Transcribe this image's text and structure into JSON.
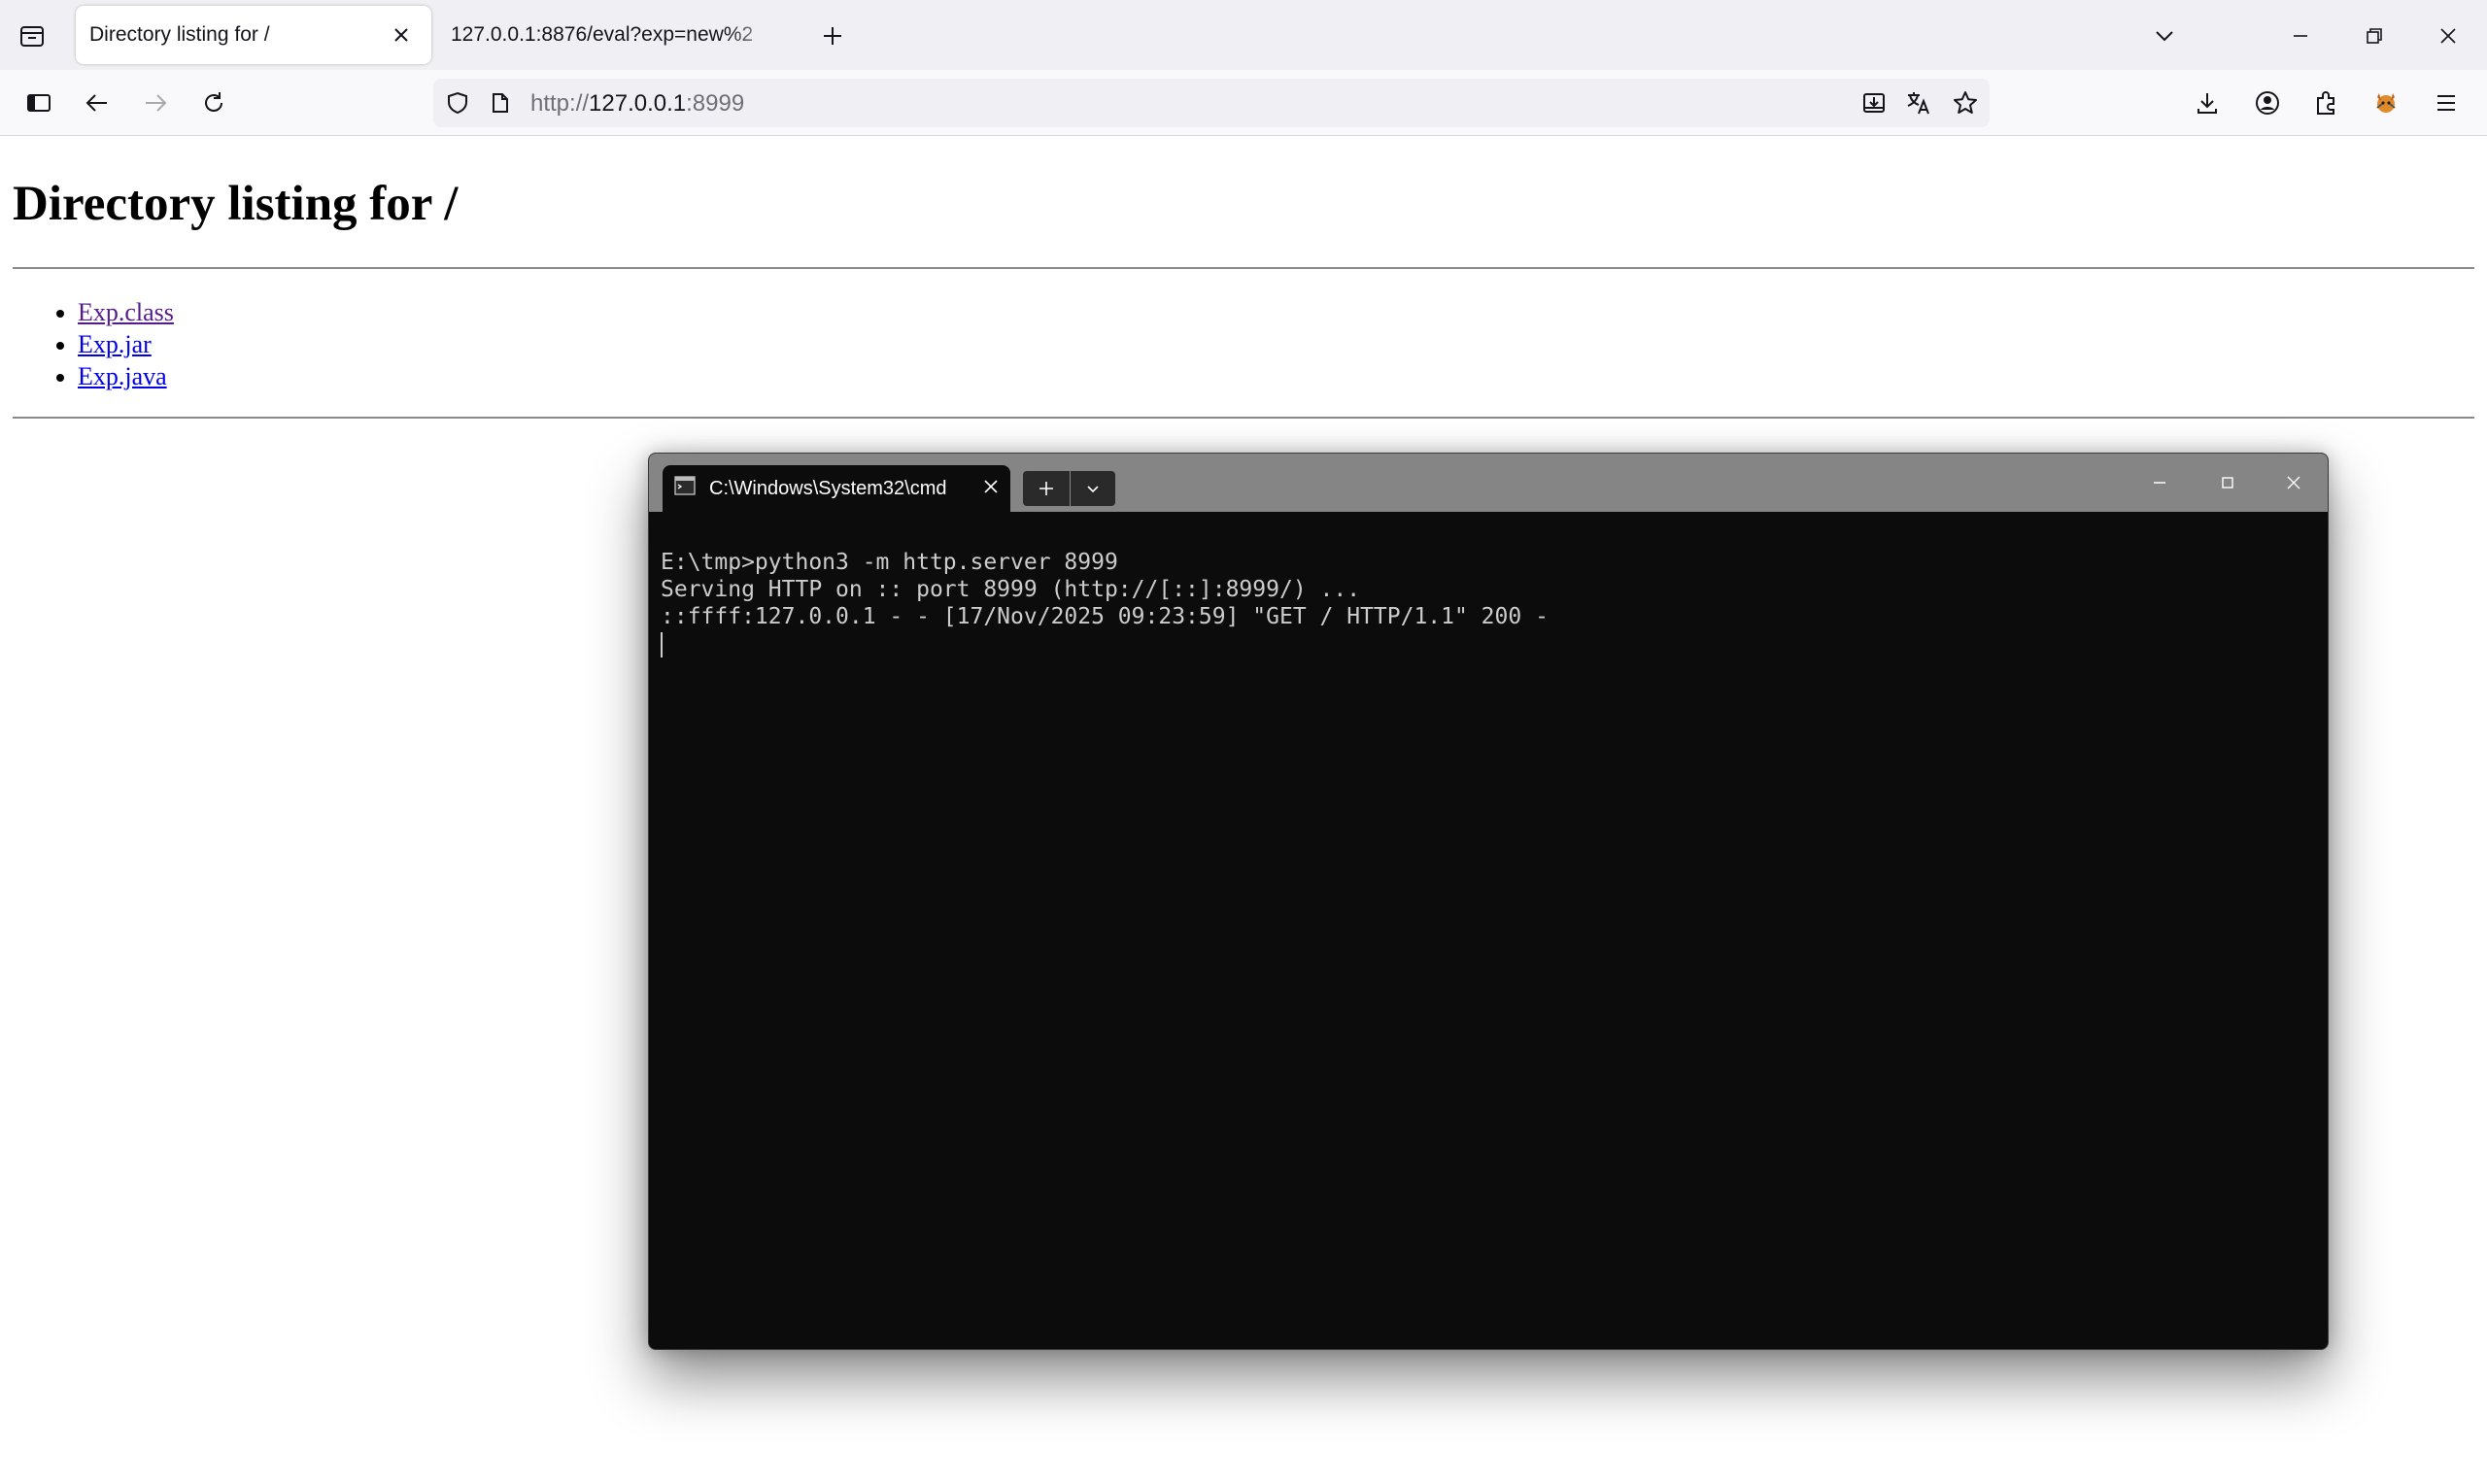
{
  "browser": {
    "tabs": [
      {
        "title": "Directory listing for /",
        "active": true
      },
      {
        "title": "127.0.0.1:8876/eval?exp=new%2",
        "active": false
      }
    ],
    "url": {
      "scheme": "http://",
      "host": "127.0.0.1",
      "port": ":8999"
    }
  },
  "page": {
    "heading": "Directory listing for /",
    "files": [
      {
        "name": "Exp.class",
        "visited": true
      },
      {
        "name": "Exp.jar",
        "visited": false
      },
      {
        "name": "Exp.java",
        "visited": false
      }
    ]
  },
  "terminal": {
    "tab_title": "C:\\Windows\\System32\\cmd",
    "lines": [
      "E:\\tmp>python3 -m http.server 8999",
      "Serving HTTP on :: port 8999 (http://[::]:8999/) ...",
      "::ffff:127.0.0.1 - - [17/Nov/2025 09:23:59] \"GET / HTTP/1.1\" 200 -"
    ]
  },
  "colors": {
    "link": "#0000ee",
    "link_visited": "#551a8b",
    "terminal_bg": "#0c0c0c",
    "terminal_fg": "#cccccc"
  }
}
